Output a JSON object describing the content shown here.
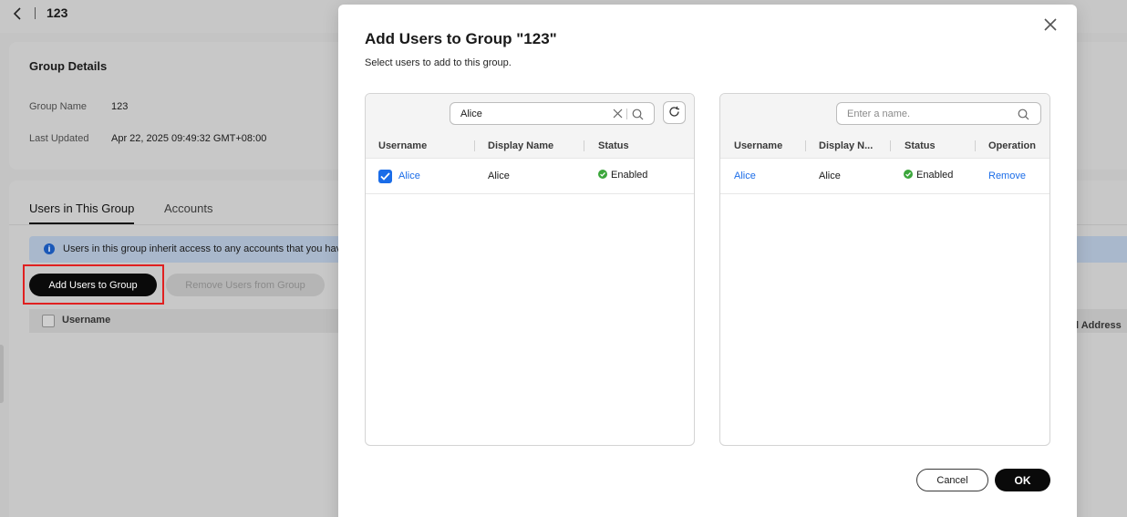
{
  "page": {
    "title": "123"
  },
  "details": {
    "heading": "Group Details",
    "group_name_label": "Group Name",
    "group_name_value": "123",
    "last_updated_label": "Last Updated",
    "last_updated_value": "Apr 22, 2025 09:49:32 GMT+08:00"
  },
  "tabs": [
    {
      "label": "Users in This Group",
      "active": true
    },
    {
      "label": "Accounts",
      "active": false
    }
  ],
  "info_banner": "Users in this group inherit access to any accounts that you have",
  "actions": {
    "add_users": "Add Users to Group",
    "remove_users": "Remove Users from Group"
  },
  "bg_table": {
    "col_username": "Username",
    "col_address_partial": "l Address"
  },
  "modal": {
    "title": "Add Users to Group \"123\"",
    "subtitle": "Select users to add to this group.",
    "left_panel": {
      "search_value": "Alice",
      "columns": [
        "Username",
        "Display Name",
        "Status"
      ],
      "rows": [
        {
          "username": "Alice",
          "display_name": "Alice",
          "status": "Enabled",
          "checked": true
        }
      ]
    },
    "right_panel": {
      "search_placeholder": "Enter a name.",
      "columns": [
        "Username",
        "Display N...",
        "Status",
        "Operation"
      ],
      "rows": [
        {
          "username": "Alice",
          "display_name": "Alice",
          "status": "Enabled",
          "operation": "Remove"
        }
      ]
    },
    "cancel_label": "Cancel",
    "ok_label": "OK"
  },
  "colors": {
    "link": "#1a6ce8",
    "status_enabled": "#3ba63b",
    "primary_button": "#0a0a0a",
    "highlight": "#e02020"
  }
}
